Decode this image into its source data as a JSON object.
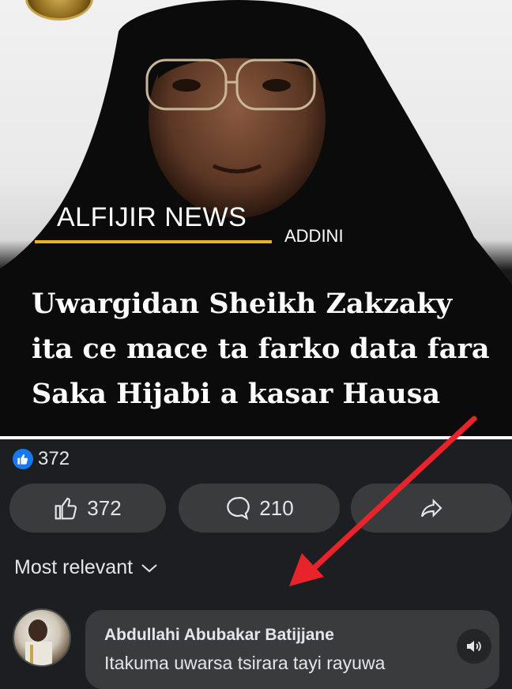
{
  "post": {
    "brand": "ALFIJIR NEWS",
    "category": "ADDINI",
    "headline_lines": [
      "Uwargidan Sheikh Zakzaky",
      "ita ce mace ta farko data fara",
      "Saka Hijabi a kasar Hausa"
    ],
    "accent_color": "#e7b421"
  },
  "reactions": {
    "count": "372",
    "icon": "like-icon"
  },
  "actions": {
    "like_count": "372",
    "comment_count": "210",
    "share_icon": "share-icon"
  },
  "comments": {
    "sort_label": "Most relevant",
    "items": [
      {
        "author": "Abdullahi Abubakar Batijjane",
        "text": "Itakuma uwarsa tsirara tayi rayuwa"
      }
    ]
  },
  "annotation": {
    "color": "#e8242a"
  }
}
